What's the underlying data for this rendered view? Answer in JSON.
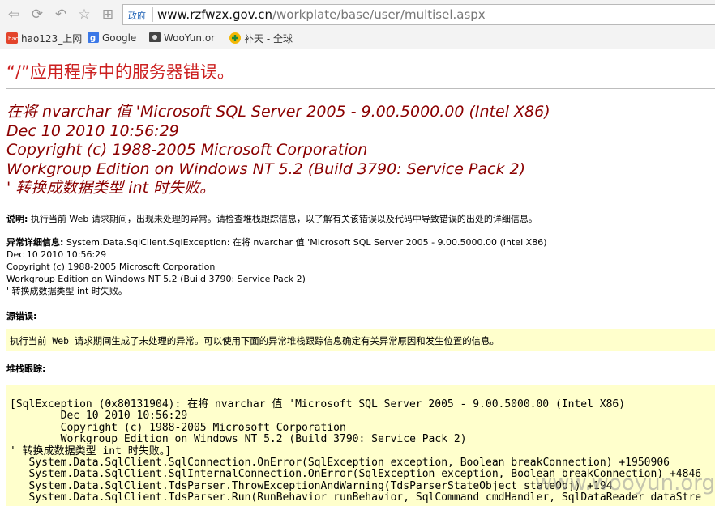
{
  "browser": {
    "nav": {
      "back": "⇦",
      "refresh": "⟳",
      "undo": "↶",
      "favorite": "☆",
      "apps": "⊞"
    },
    "url_prefix_tag": "政府",
    "url_host": "www.rzfwzx.gov.cn",
    "url_path": "/workplate/base/user/multisel.aspx",
    "bookmarks": [
      {
        "label": "hao123_上网",
        "icon": "hao123-icon"
      },
      {
        "label": "Google",
        "icon": "google-icon"
      },
      {
        "label": "WooYun.or",
        "icon": "wooyun-icon"
      },
      {
        "label": "补天 - 全球",
        "icon": "butian-icon"
      }
    ]
  },
  "error": {
    "title": "“/”应用程序中的服务器错误。",
    "heading_lines": [
      "在将 nvarchar 值 'Microsoft SQL Server 2005 - 9.00.5000.00 (Intel X86)",
      "Dec 10 2010 10:56:29",
      "Copyright (c) 1988-2005 Microsoft Corporation",
      "Workgroup Edition on Windows NT 5.2 (Build 3790: Service Pack 2)",
      "' 转换成数据类型 int 时失败。"
    ],
    "description_label": "说明:",
    "description_text": " 执行当前 Web 请求期间，出现未处理的异常。请检查堆栈跟踪信息，以了解有关该错误以及代码中导致错误的出处的详细信息。",
    "exception_label": "异常详细信息:",
    "exception_lines": [
      " System.Data.SqlClient.SqlException: 在将 nvarchar 值 'Microsoft SQL Server 2005 - 9.00.5000.00 (Intel X86)",
      "Dec 10 2010 10:56:29",
      "Copyright (c) 1988-2005 Microsoft Corporation",
      "Workgroup Edition on Windows NT 5.2 (Build 3790: Service Pack 2)",
      "' 转换成数据类型 int 时失败。"
    ],
    "source_error_label": "源错误:",
    "source_error_text": "执行当前 Web 请求期间生成了未处理的异常。可以使用下面的异常堆栈跟踪信息确定有关异常原因和发生位置的信息。",
    "stack_trace_label": "堆栈跟踪:",
    "stack_trace_lines": [
      "[SqlException (0x80131904): 在将 nvarchar 值 'Microsoft SQL Server 2005 - 9.00.5000.00 (Intel X86)",
      "        Dec 10 2010 10:56:29",
      "        Copyright (c) 1988-2005 Microsoft Corporation",
      "        Workgroup Edition on Windows NT 5.2 (Build 3790: Service Pack 2)",
      "' 转换成数据类型 int 时失败。]",
      "   System.Data.SqlClient.SqlConnection.OnError(SqlException exception, Boolean breakConnection) +1950906",
      "   System.Data.SqlClient.SqlInternalConnection.OnError(SqlException exception, Boolean breakConnection) +4846",
      "   System.Data.SqlClient.TdsParser.ThrowExceptionAndWarning(TdsParserStateObject stateObj) +194",
      "   System.Data.SqlClient.TdsParser.Run(RunBehavior runBehavior, SqlCommand cmdHandler, SqlDataReader dataStre"
    ]
  },
  "watermark": "www.wooyun.org"
}
